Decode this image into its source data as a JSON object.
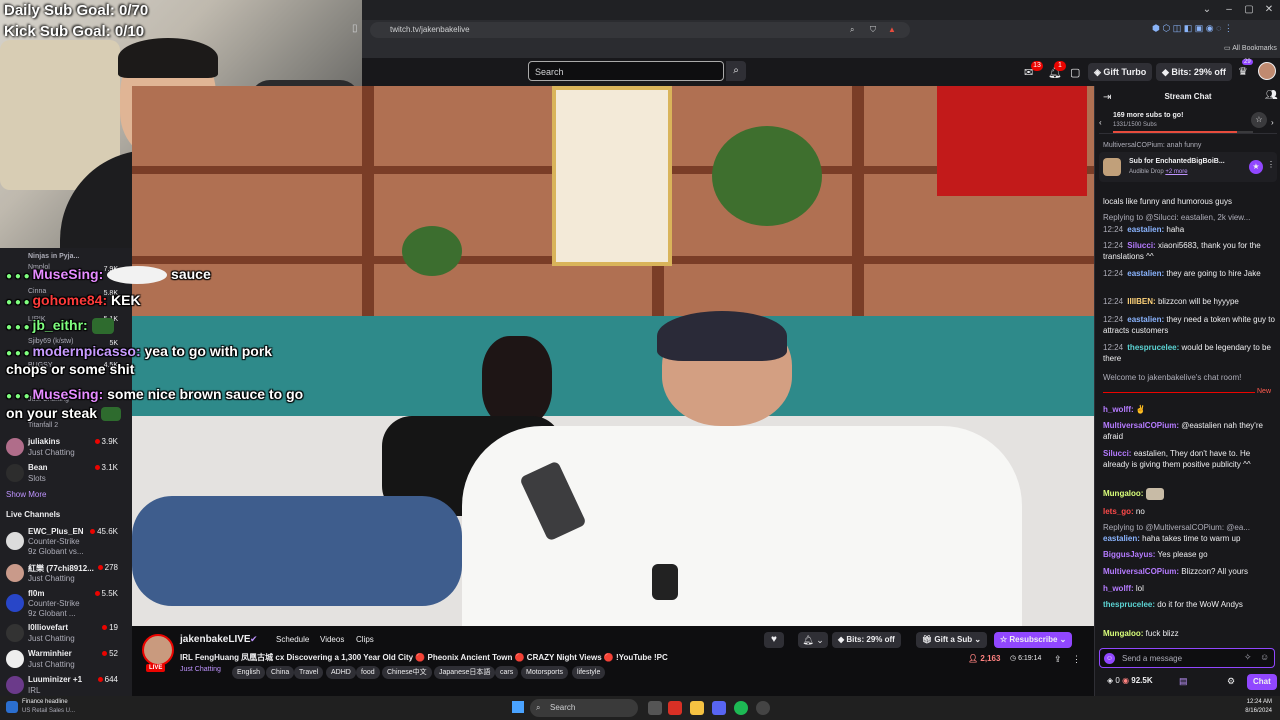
{
  "overlay": {
    "daily_goal": "Daily Sub Goal: 0/70",
    "kick_goal": "Kick Sub Goal: 0/10"
  },
  "browser": {
    "url": "twitch.tv/jakenbakelive",
    "all_bookmarks": "All Bookmarks"
  },
  "topnav": {
    "search_placeholder": "Search",
    "gift_turbo": "Gift Turbo",
    "bits": "Bits: 29% off",
    "notif_count_1": "13",
    "notif_count_2": "1",
    "prime_count": "29"
  },
  "overlay_chat": [
    {
      "user": "MuseSing:",
      "text": "sauce",
      "color": "#e58bff"
    },
    {
      "user": "gohome84:",
      "text": "KEK",
      "color": "#ff3b3b"
    },
    {
      "user": "jb_eithr:",
      "text": "",
      "color": "#7fff7f"
    },
    {
      "user": "modernpicasso:",
      "text": "yea to go with pork",
      "color": "#c89bff"
    },
    {
      "user": "",
      "text": "chops or some shit",
      "color": "#ffffff"
    },
    {
      "user": "MuseSing:",
      "text": "some nice brown sauce to go",
      "color": "#e58bff"
    },
    {
      "user": "",
      "text": "on your steak",
      "color": "#ffffff"
    }
  ],
  "sidebar": {
    "followed": [
      {
        "name": "Ninjas in Pyja...",
        "game": "",
        "count": ""
      },
      {
        "name": "Nmplol",
        "game": "",
        "count": "7.9K"
      },
      {
        "name": "Cinna",
        "game": "",
        "count": "5.8K"
      },
      {
        "name": "LIRIK",
        "game": "",
        "count": "5.1K"
      },
      {
        "name": "Sjiby69 (k/stw)",
        "game": "",
        "count": "5K"
      },
      {
        "name": "BUGSY",
        "game": "",
        "count": "4.5K"
      },
      {
        "name": "Just Chatting",
        "game": "",
        "count": ""
      },
      {
        "name": "Titanfall 2",
        "game": "",
        "count": ""
      },
      {
        "name": "juliakins",
        "game": "Just Chatting",
        "count": "3.9K"
      },
      {
        "name": "Bean",
        "game": "Slots",
        "count": "3.1K"
      }
    ],
    "show_more": "Show More",
    "live_channels_title": "Live Channels",
    "live_channels": [
      {
        "name": "EWC_Plus_EN",
        "game": "Counter-Strike",
        "extra": "9z Globant vs...",
        "count": "45.6K"
      },
      {
        "name": "紅樂 (77chi8912...",
        "game": "Just Chatting",
        "extra": "",
        "count": "278"
      },
      {
        "name": "fl0m",
        "game": "Counter-Strike",
        "extra": "9z Globant ...",
        "count": "5.5K"
      },
      {
        "name": "l0lliovefart",
        "game": "Just Chatting",
        "extra": "",
        "count": "19"
      },
      {
        "name": "Warminhier",
        "game": "Just Chatting",
        "extra": "",
        "count": "52"
      },
      {
        "name": "Luuminizer +1",
        "game": "IRL",
        "extra": "",
        "count": "644"
      }
    ]
  },
  "channel": {
    "name": "jakenbakeLIVE",
    "live_badge": "LIVE",
    "nav": [
      "Schedule",
      "Videos",
      "Clips"
    ],
    "title": "IRL FengHuang 凤凰古城 cx Discovering a 1,300 Year Old City 🔴 Pheonix Ancient Town 🔴 CRAZY Night Views 🔴 !YouTube !PC",
    "category": "Just Chatting",
    "tags": [
      "English",
      "China",
      "Travel",
      "ADHD",
      "food",
      "Chinese中文",
      "Japanese日本語",
      "cars",
      "Motorsports",
      "lifestyle"
    ],
    "bits": "Bits: 29% off",
    "gift_sub": "Gift a Sub",
    "resubscribe": "Resubscribe",
    "viewers": "2,163",
    "uptime": "6:19:14"
  },
  "chat": {
    "title": "Stream Chat",
    "hype_title": "169 more subs to go!",
    "hype_sub": "1331/1500 Subs",
    "pinned_top": "MultiversalCOPium: anah funny",
    "drop_title": "Sub for EnchantedBigBoiB...",
    "drop_sub": "Audible Drop",
    "drop_more": "+2 more",
    "messages_before": [
      {
        "ts": "",
        "user": "",
        "color": "#adadb8",
        "text": "locals like funny and humorous guys"
      },
      {
        "ts": "",
        "user": "",
        "color": "#adadb8",
        "text": "Replying to @Silucci: eastalien, 2k view..."
      },
      {
        "ts": "12:24",
        "user": "eastalien:",
        "color": "#8ab4ff",
        "text": "haha"
      },
      {
        "ts": "12:24",
        "user": "Silucci:",
        "color": "#b57bff",
        "text": "xiaoni5683, thank you for the translations ^^"
      },
      {
        "ts": "12:24",
        "user": "eastalien:",
        "color": "#8ab4ff",
        "text": "they are going to hire Jake"
      },
      {
        "ts": "12:24",
        "user": "IIIIBEN:",
        "color": "#ffd37a",
        "text": "blizzcon will be hyyype"
      },
      {
        "ts": "12:24",
        "user": "eastalien:",
        "color": "#8ab4ff",
        "text": "they need a token white guy to attracts customers"
      },
      {
        "ts": "12:24",
        "user": "thesprucelee:",
        "color": "#5cd4d4",
        "text": "would be legendary to be there"
      }
    ],
    "welcome": "Welcome to jakenbakelive's chat room!",
    "new_label": "New",
    "messages_after": [
      {
        "user": "h_wolff:",
        "color": "#b57bff",
        "text": ""
      },
      {
        "user": "MultiversalCOPium:",
        "color": "#b57bff",
        "text": "@eastalien nah they're afraid"
      },
      {
        "user": "Silucci:",
        "color": "#b57bff",
        "text": "eastalien, They don't have to. He already is giving them positive publicity ^^"
      },
      {
        "user": "Mungaloo:",
        "color": "#d9ff7a",
        "text": ""
      },
      {
        "user": "lets_go:",
        "color": "#ff4a4a",
        "text": "no"
      },
      {
        "user": "",
        "color": "#adadb8",
        "text": "Replying to @MultiversalCOPium: @ea..."
      },
      {
        "user": "eastalien:",
        "color": "#8ab4ff",
        "text": "haha takes time to warm up"
      },
      {
        "user": "BiggusJayus:",
        "color": "#b57bff",
        "text": "Yes please go"
      },
      {
        "user": "MultiversalCOPium:",
        "color": "#b57bff",
        "text": "Blizzcon? All yours"
      },
      {
        "user": "h_wolff:",
        "color": "#b57bff",
        "text": "lol"
      },
      {
        "user": "thesprucelee:",
        "color": "#5cd4d4",
        "text": "do it for the WoW Andys"
      },
      {
        "user": "Mungaloo:",
        "color": "#d9ff7a",
        "text": "fuck blizz"
      }
    ],
    "input_placeholder": "Send a message",
    "points": "0",
    "channel_points": "92.5K",
    "chat_button": "Chat"
  },
  "taskbar": {
    "news_title": "Finance headline",
    "news_sub": "US Retail Sales U...",
    "search": "Search",
    "time": "12:24 AM",
    "date": "8/16/2024"
  }
}
